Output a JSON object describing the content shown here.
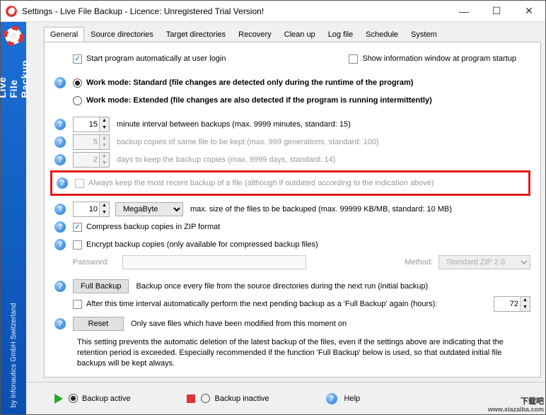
{
  "window": {
    "title": "Settings - Live File Backup - Licence: Unregistered Trial Version!"
  },
  "sidebar": {
    "product": "Live File Backup",
    "vendor": "by Infonautics GmbH Switzerland"
  },
  "tabs": [
    "General",
    "Source directories",
    "Target directories",
    "Recovery",
    "Clean up",
    "Log file",
    "Schedule",
    "System"
  ],
  "general": {
    "autostart": "Start program automatically at user login",
    "showinfo": "Show information window at program startup",
    "mode_std": "Work mode: Standard (file changes are detected only during the runtime of the program)",
    "mode_ext": "Work mode: Extended (file changes are also detected if the program is running intermittently)",
    "interval_val": "15",
    "interval_lbl": "minute interval between backups (max. 9999 minutes, standard: 15)",
    "copies_val": "5",
    "copies_lbl": "backup copies of same file to be kept (max. 999 generations, standard: 100)",
    "days_val": "2",
    "days_lbl": "days to keep the backup copies (max. 9999 days, standard: 14)",
    "always_keep": "Always keep the most recent backup of a file (although if outdated according to the indication above)",
    "maxsize_val": "10",
    "maxsize_unit": "MegaByte",
    "maxsize_lbl": "max. size of the files to be backuped (max. 99999 KB/MB, standard: 10 MB)",
    "compress": "Compress backup copies in ZIP format",
    "encrypt": "Encrypt backup copies (only available for compressed backup files)",
    "pw_lbl": "Password:",
    "method_lbl": "Method:",
    "method_val": "Standard ZIP 2.0",
    "fullbackup_btn": "Full Backup",
    "fullbackup_lbl": "Backup once every file from the source directories during the next run (initial backup)",
    "after_lbl": "After this time interval automatically perform the next pending backup as a 'Full Backup' again (hours):",
    "after_val": "72",
    "reset_btn": "Reset",
    "reset_lbl": "Only save files which have been modified from this moment on",
    "info": "This setting prevents the automatic deletion of the latest backup of the files, even if the settings above are indicating that the retention period is exceeded. Especially recommended if the function 'Full Backup' below is used, so that outdated initial file backups will be kept always."
  },
  "footer": {
    "active": "Backup active",
    "inactive": "Backup inactive",
    "help": "Help"
  },
  "watermark": {
    "big": "下载吧",
    "url": "www.xiazaiba.com"
  }
}
